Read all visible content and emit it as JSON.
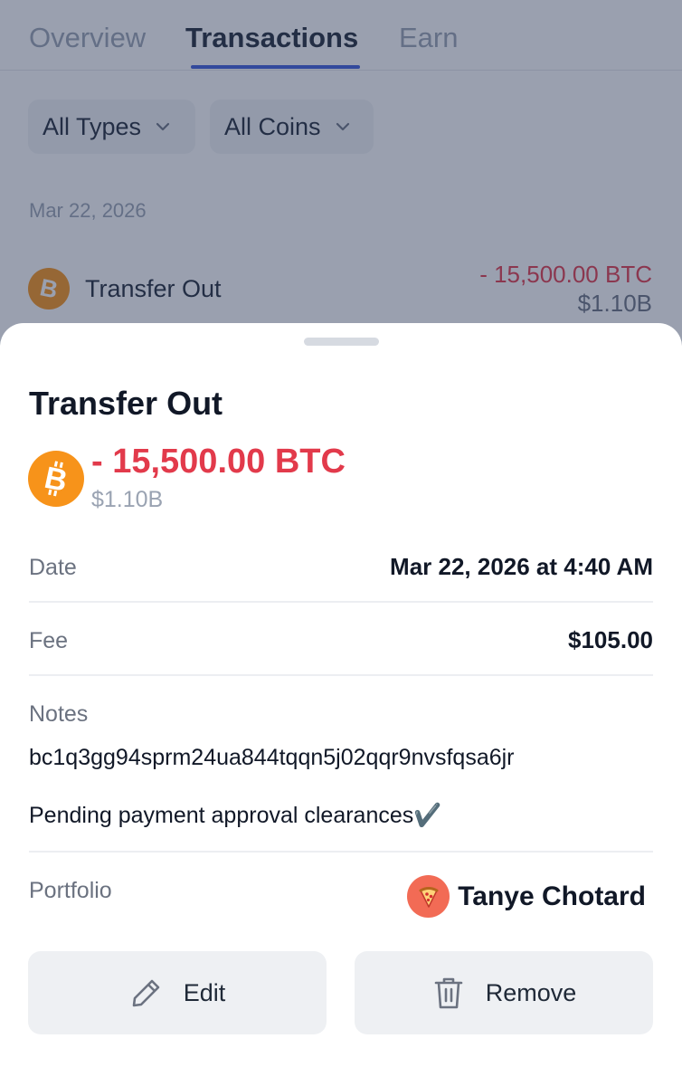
{
  "tabs": [
    {
      "label": "Overview",
      "active": false
    },
    {
      "label": "Transactions",
      "active": true
    },
    {
      "label": "Earn",
      "active": false
    }
  ],
  "filters": {
    "types": "All Types",
    "coins": "All Coins"
  },
  "list": {
    "date_group": "Mar 22, 2026",
    "item": {
      "label": "Transfer Out",
      "amount": "- 15,500.00 BTC",
      "usd": "$1.10B",
      "coin_icon": "bitcoin-icon"
    }
  },
  "sheet": {
    "title": "Transfer Out",
    "amount": "- 15,500.00 BTC",
    "usd": "$1.10B",
    "coin_icon": "bitcoin-icon",
    "date": {
      "label": "Date",
      "value": "Mar 22, 2026 at 4:40 AM"
    },
    "fee": {
      "label": "Fee",
      "value": "$105.00"
    },
    "notes": {
      "label": "Notes",
      "lines": [
        "bc1q3gg94sprm24ua844tqqn5j02qqr9nvsfqsa6jr",
        "Pending payment approval clearances✔️"
      ]
    },
    "portfolio": {
      "label": "Portfolio",
      "name": "Tanye Chotard",
      "avatar_icon": "pizza-icon"
    },
    "actions": {
      "edit": {
        "label": "Edit",
        "icon": "pencil-icon"
      },
      "remove": {
        "label": "Remove",
        "icon": "trash-icon"
      }
    }
  },
  "colors": {
    "negative": "#e23a4b",
    "bitcoin": "#f7931a",
    "tab_accent": "#3b5bdb",
    "avatar_bg": "#f26b55",
    "button_bg": "#eef0f3"
  }
}
